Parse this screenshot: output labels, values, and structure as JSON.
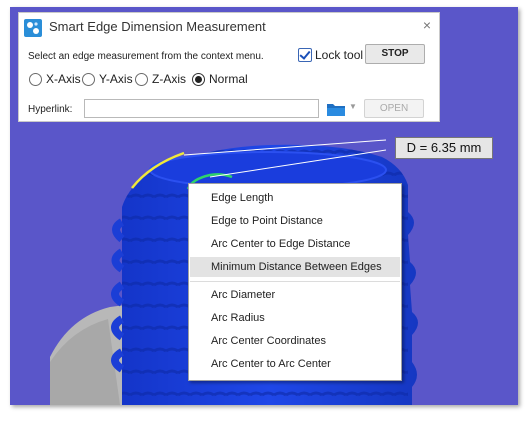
{
  "dialog": {
    "title": "Smart Edge Dimension Measurement",
    "close": "×",
    "instruction": "Select an edge measurement from the context menu.",
    "lock_label": "Lock tool",
    "lock_checked": true,
    "stop_label": "STOP",
    "radios": [
      {
        "label": "X-Axis",
        "selected": false
      },
      {
        "label": "Y-Axis",
        "selected": false
      },
      {
        "label": "Z-Axis",
        "selected": false
      },
      {
        "label": "Normal",
        "selected": true
      }
    ],
    "hyperlink_label": "Hyperlink:",
    "hyperlink_value": "",
    "open_label": "OPEN"
  },
  "measurement": {
    "label": "D = 6.35 mm"
  },
  "context_menu": {
    "items": [
      {
        "label": "Edge Length",
        "highlighted": false
      },
      {
        "label": "Edge to Point Distance",
        "highlighted": false
      },
      {
        "label": "Arc Center to Edge Distance",
        "highlighted": false
      },
      {
        "label": "Minimum Distance Between Edges",
        "highlighted": true
      },
      {
        "label": "Arc Diameter",
        "highlighted": false
      },
      {
        "label": "Arc Radius",
        "highlighted": false
      },
      {
        "label": "Arc Center Coordinates",
        "highlighted": false
      },
      {
        "label": "Arc Center to Arc Center",
        "highlighted": false
      }
    ]
  },
  "colors": {
    "viewport_bg": "#5a56c9",
    "part_blue": "#1c3fd9",
    "selected_edge_1": "#f0e83a",
    "selected_edge_2": "#2ed36a",
    "menu_highlight": "#e3e3e3"
  },
  "icons": {
    "app": "smart-edge-app-icon",
    "folder": "folder-icon",
    "close": "close-icon"
  }
}
